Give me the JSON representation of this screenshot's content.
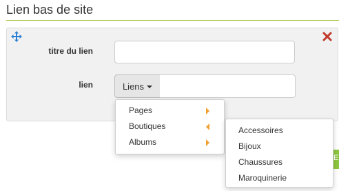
{
  "section": {
    "title": "Lien bas de site"
  },
  "form": {
    "titre_label": "titre du lien",
    "titre_value": "",
    "lien_label": "lien",
    "lien_button": "Liens",
    "lien_value": ""
  },
  "menu": {
    "items": [
      {
        "label": "Pages",
        "arrow": "right"
      },
      {
        "label": "Boutiques",
        "arrow": "left"
      },
      {
        "label": "Albums",
        "arrow": "right"
      }
    ]
  },
  "submenu": {
    "items": [
      {
        "label": "Accessoires"
      },
      {
        "label": "Bijoux"
      },
      {
        "label": "Chaussures"
      },
      {
        "label": "Maroquinerie"
      }
    ]
  },
  "side_button": {
    "label": "E"
  },
  "colors": {
    "accent": "#9cc33f",
    "arrow": "#f0a030",
    "close": "#c0392b",
    "move": "#2a7fd4"
  },
  "icons": {
    "move": "move-arrows-icon",
    "close": "close-icon"
  }
}
